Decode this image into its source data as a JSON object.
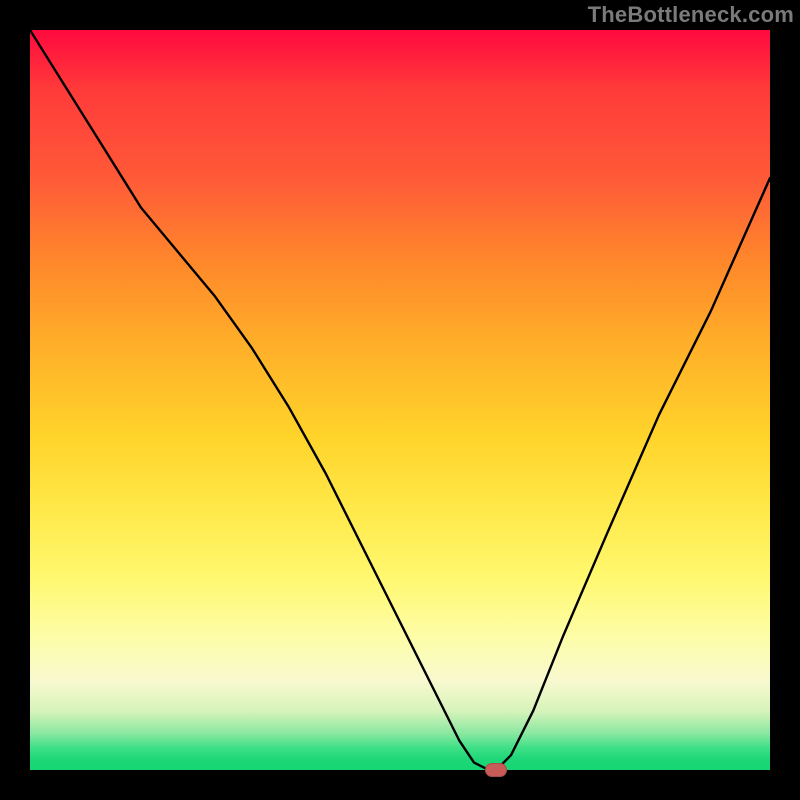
{
  "watermark": "TheBottleneck.com",
  "chart_data": {
    "type": "line",
    "title": "",
    "xlabel": "",
    "ylabel": "",
    "xlim": [
      0,
      100
    ],
    "ylim": [
      0,
      100
    ],
    "legend": false,
    "grid": false,
    "background_gradient": {
      "top": "#ff0a3e",
      "upper_mid": "#ffad29",
      "mid": "#ffe94a",
      "lower_mid": "#f8f9cf",
      "bottom": "#14d573"
    },
    "series": [
      {
        "name": "bottleneck-curve",
        "x": [
          0,
          5,
          10,
          15,
          20,
          25,
          30,
          35,
          40,
          45,
          50,
          55,
          58,
          60,
          62,
          63,
          65,
          68,
          72,
          78,
          85,
          92,
          100
        ],
        "y": [
          100,
          92,
          84,
          76,
          70,
          64,
          57,
          49,
          40,
          30,
          20,
          10,
          4,
          1,
          0,
          0,
          2,
          8,
          18,
          32,
          48,
          62,
          80
        ]
      }
    ],
    "marker": {
      "x": 63,
      "y": 0,
      "color": "#c85a58"
    }
  }
}
